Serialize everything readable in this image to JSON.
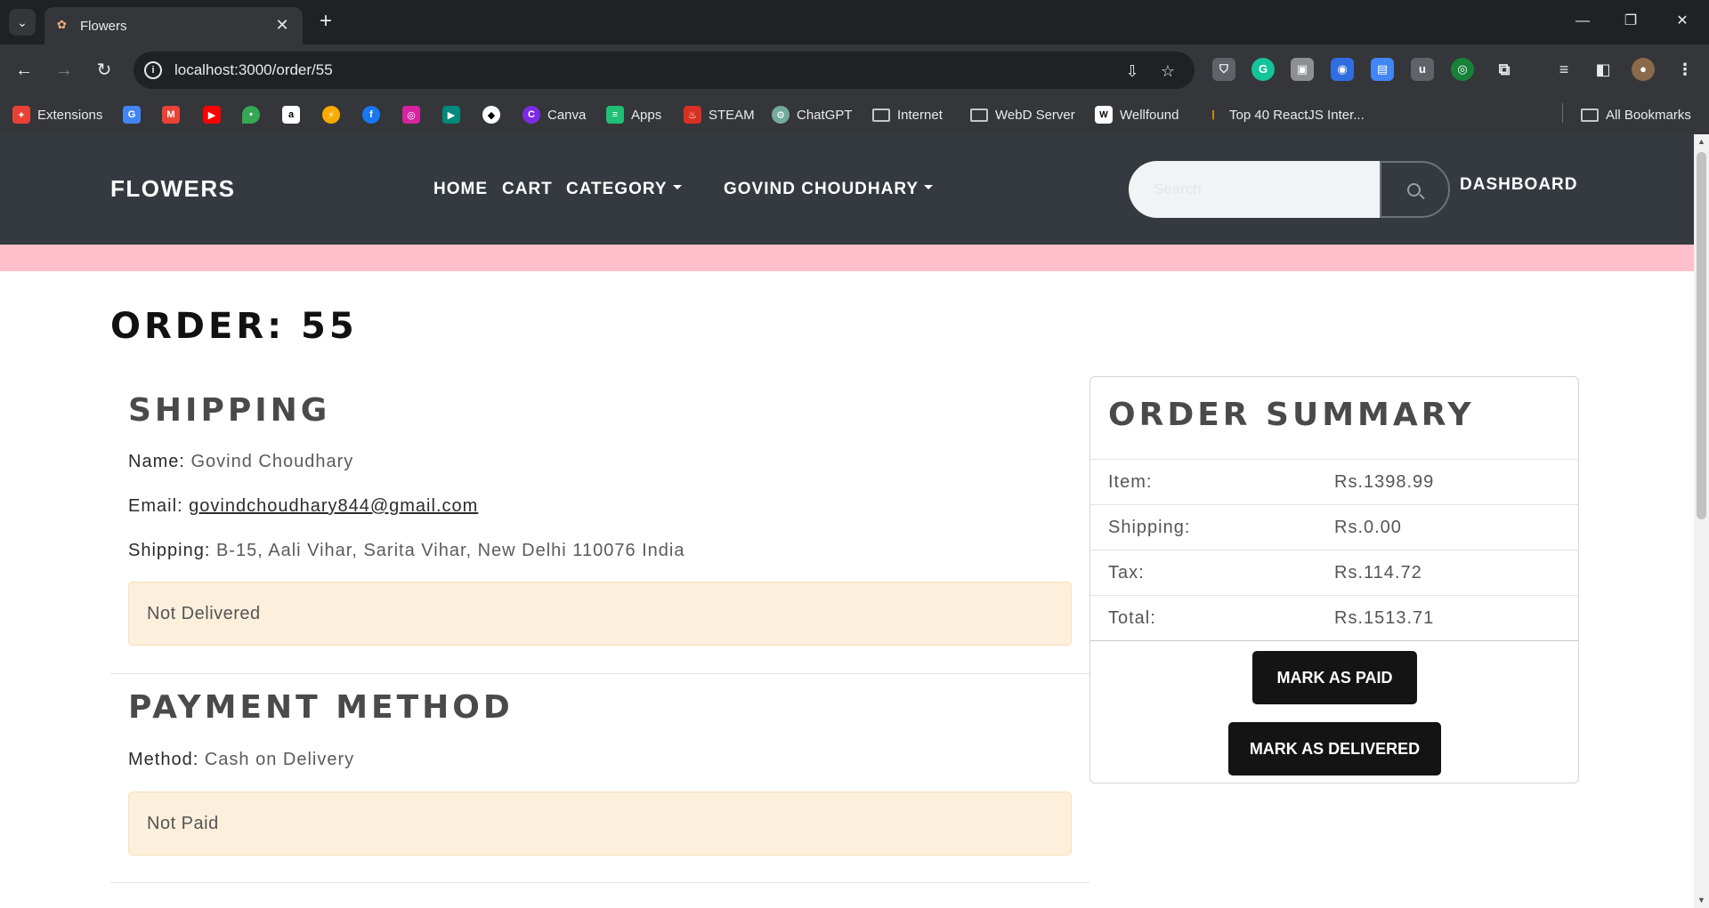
{
  "browser": {
    "tab_title": "Flowers",
    "url": "localhost:3000/order/55",
    "bookmarks": [
      {
        "label": "Extensions",
        "icon": "extensions-icon"
      },
      {
        "label": "",
        "icon": "google-translate-icon"
      },
      {
        "label": "",
        "icon": "gmail-icon"
      },
      {
        "label": "",
        "icon": "youtube-icon"
      },
      {
        "label": "",
        "icon": "maps-icon"
      },
      {
        "label": "",
        "icon": "amazon-icon"
      },
      {
        "label": "",
        "icon": "lightning-icon"
      },
      {
        "label": "",
        "icon": "facebook-icon"
      },
      {
        "label": "",
        "icon": "instagram-icon"
      },
      {
        "label": "",
        "icon": "meet-icon"
      },
      {
        "label": "",
        "icon": "github-icon"
      },
      {
        "label": "Canva",
        "icon": "canva-icon"
      },
      {
        "label": "Apps",
        "icon": "apps-icon"
      },
      {
        "label": "STEAM",
        "icon": "steam-icon"
      },
      {
        "label": "ChatGPT",
        "icon": "chatgpt-icon"
      },
      {
        "label": "Internet",
        "icon": "folder-icon"
      },
      {
        "label": "WebD Server",
        "icon": "folder-icon"
      },
      {
        "label": "Wellfound",
        "icon": "wellfound-icon"
      },
      {
        "label": "Top 40 ReactJS Inter...",
        "icon": "bookmark-page-icon"
      },
      {
        "label": "All Bookmarks",
        "icon": "folder-icon"
      }
    ]
  },
  "navbar": {
    "brand": "FLOWERS",
    "home": "HOME",
    "cart": "CART",
    "category": "CATEGORY",
    "user": "GOVIND CHOUDHARY",
    "search_placeholder": "Search",
    "dashboard": "DASHBOARD"
  },
  "order": {
    "title": "ORDER: 55",
    "shipping": {
      "heading": "SHIPPING",
      "name_label": "Name:",
      "name": "Govind Choudhary",
      "email_label": "Email:",
      "email": "govindchoudhary844@gmail.com",
      "address_label": "Shipping:",
      "address": "B-15, Aali Vihar, Sarita Vihar, New Delhi 110076 India",
      "status": "Not Delivered"
    },
    "payment": {
      "heading": "PAYMENT METHOD",
      "method_label": "Method:",
      "method": "Cash on Delivery",
      "status": "Not Paid"
    }
  },
  "summary": {
    "heading": "ORDER SUMMARY",
    "rows": [
      {
        "label": "Item:",
        "value": "Rs.1398.99"
      },
      {
        "label": "Shipping:",
        "value": "Rs.0.00"
      },
      {
        "label": "Tax:",
        "value": "Rs.114.72"
      },
      {
        "label": "Total:",
        "value": "Rs.1513.71"
      }
    ],
    "mark_paid": "MARK AS PAID",
    "mark_delivered": "MARK AS DELIVERED"
  }
}
